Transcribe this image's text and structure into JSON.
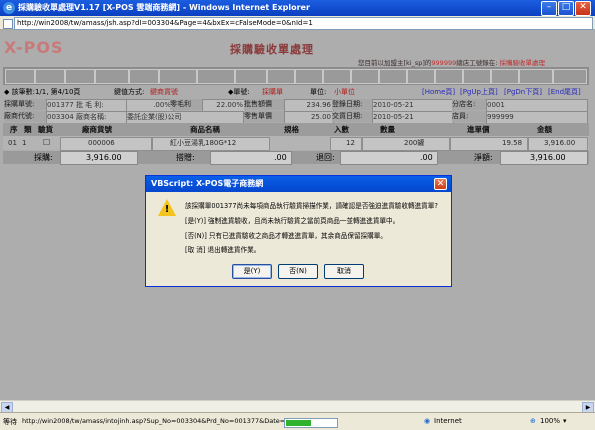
{
  "window": {
    "title": "採購驗收單處理V1.17 [X-POS 雲端商務網] - Windows Internet Explorer",
    "address": "http://win2008/tw/amass/jsh.asp?dI=003304&Page=4&bxEx=cFalseMode=0&nId=1"
  },
  "page": {
    "brand": "X-POS",
    "title": "採購驗收單處理",
    "notice_prefix": "您目前以加盟主[ki_sp]的",
    "notice_red": "999999",
    "notice_mid": "總店工號錄在: ",
    "notice_link": "採購驗收單處理"
  },
  "status_row": {
    "text1": "◆ 該筆數:1/1, 第4/10頁",
    "text2": "鍵值方式:",
    "key_mode": "鍵商貨號",
    "text3": "◆單號:",
    "doc_type": "採購單",
    "unit_label": "單位:",
    "unit_value": "小單位",
    "nav": [
      "[Home頁]",
      "[PgUp上頁]",
      "[PgDn下頁]",
      "[End尾頁]"
    ]
  },
  "info": {
    "row1": {
      "l1": "採購單號:",
      "v1": "001377 批 毛 利:",
      "v1b": ".00%",
      "l2": "零毛利",
      "v2": "22.00%",
      "l3": "批售額價",
      "v3": "234.96",
      "l4": "登錄日期:",
      "v4": "2010-05-21",
      "l5": "分店名:",
      "v5": "0001"
    },
    "row2": {
      "l1": "廠商代號:",
      "v1": "003304 廠商名稱:",
      "v1b": "委託企業(股)公司",
      "l3": "零售單價",
      "v3": "25.00",
      "l4": "交貨日期:",
      "v4": "2010-05-21",
      "l5": "店員:",
      "v5": "999999"
    }
  },
  "table": {
    "headers": [
      "序",
      "類",
      "驗貨",
      "廠商貨號",
      "商品名稱",
      "規格",
      "入數",
      "數量",
      "進單價",
      "金額"
    ],
    "rows": [
      {
        "seq": "01",
        "type": "1",
        "checked": "☐",
        "vendor_code": "000006",
        "name": "紅小豆湯乳180G*12",
        "spec": "",
        "pack": "12",
        "qty": "200罐",
        "price": "19.58",
        "amount": "3,916.00"
      }
    ],
    "totals": {
      "purchase_label": "採購:",
      "purchase_value": "3,916.00",
      "discount_label": "搭贈:",
      "discount_value": ".00",
      "return_label": "退回:",
      "return_value": ".00",
      "net_label": "淨額:",
      "net_value": "3,916.00"
    }
  },
  "dialog": {
    "title": "VBScript: X-POS電子商務網",
    "lines": [
      "該採購單001377尚未每項商品執行驗貨掃描作業，請確認是否強迫進貨驗收轉進貨單?",
      "[是(Y)] 強制進貨驗收，且尚未執行驗貨之當前頁商品一並轉進進貨單中。",
      "[否(N)] 只有已進貨驗收之商品才轉進進貨單，其余商品保留採購單。",
      "[取 消] 退出轉進貨作業。"
    ],
    "buttons": {
      "yes": "是(Y)",
      "no": "否(N)",
      "cancel": "取消"
    }
  },
  "statusbar": {
    "label": "等待",
    "url": "http://win2008/tw/amass/intojinh.asp?Sup_No=003304&Prd_No=001377&Date=2010",
    "zone": "Internet",
    "zoom": "100%",
    "progress": 0.5
  }
}
